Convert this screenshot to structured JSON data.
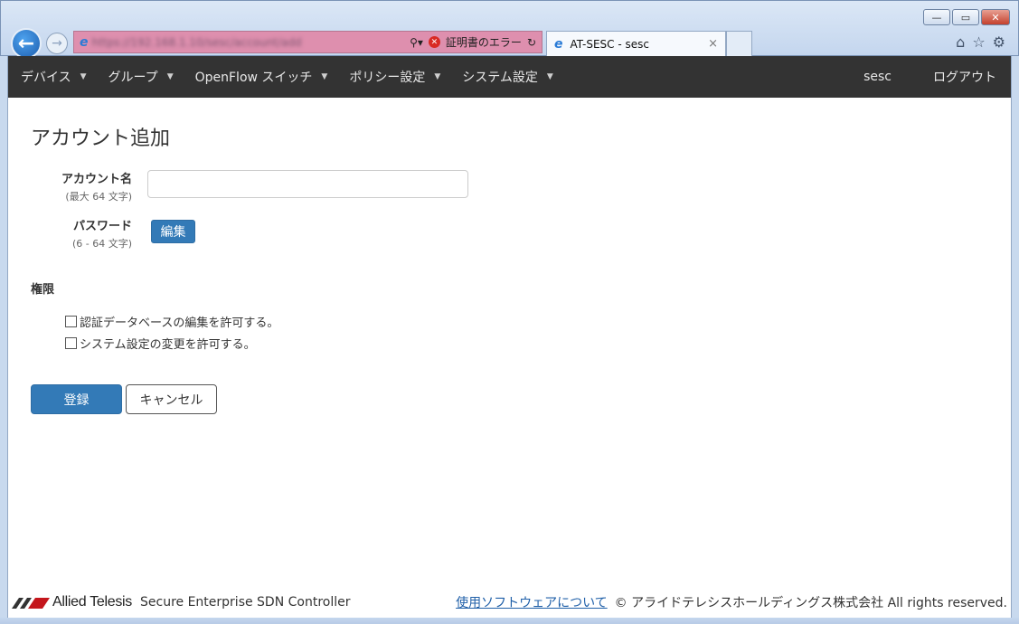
{
  "browser": {
    "url": "https://192.168.1.10/sesc/account/add",
    "cert_error": "証明書のエラー",
    "tab_title": "AT-SESC - sesc",
    "tab_close": "×",
    "win_min": "—",
    "win_max": "▭",
    "win_close": "✕"
  },
  "nav": {
    "items": [
      {
        "label": "デバイス"
      },
      {
        "label": "グループ"
      },
      {
        "label": "OpenFlow スイッチ"
      },
      {
        "label": "ポリシー設定"
      },
      {
        "label": "システム設定"
      }
    ],
    "user": "sesc",
    "logout": "ログアウト"
  },
  "form": {
    "title": "アカウント追加",
    "account_label": "アカウント名",
    "account_hint": "(最大 64 文字)",
    "account_value": "",
    "password_label": "パスワード",
    "password_hint": "(6 - 64 文字)",
    "edit_button": "編集",
    "permissions_title": "権限",
    "perm_auth_db": "認証データベースの編集を許可する。",
    "perm_system": "システム設定の変更を許可する。",
    "submit": "登録",
    "cancel": "キャンセル"
  },
  "footer": {
    "brand": "Allied Telesis",
    "product": "Secure Enterprise SDN Controller",
    "link": "使用ソフトウェアについて",
    "copyright": "© アライドテレシスホールディングス株式会社 All rights reserved."
  },
  "colors": {
    "navbar": "#333333",
    "primary": "#337ab7",
    "address_error": "#de8fae",
    "logo_red": "#c4161c"
  }
}
